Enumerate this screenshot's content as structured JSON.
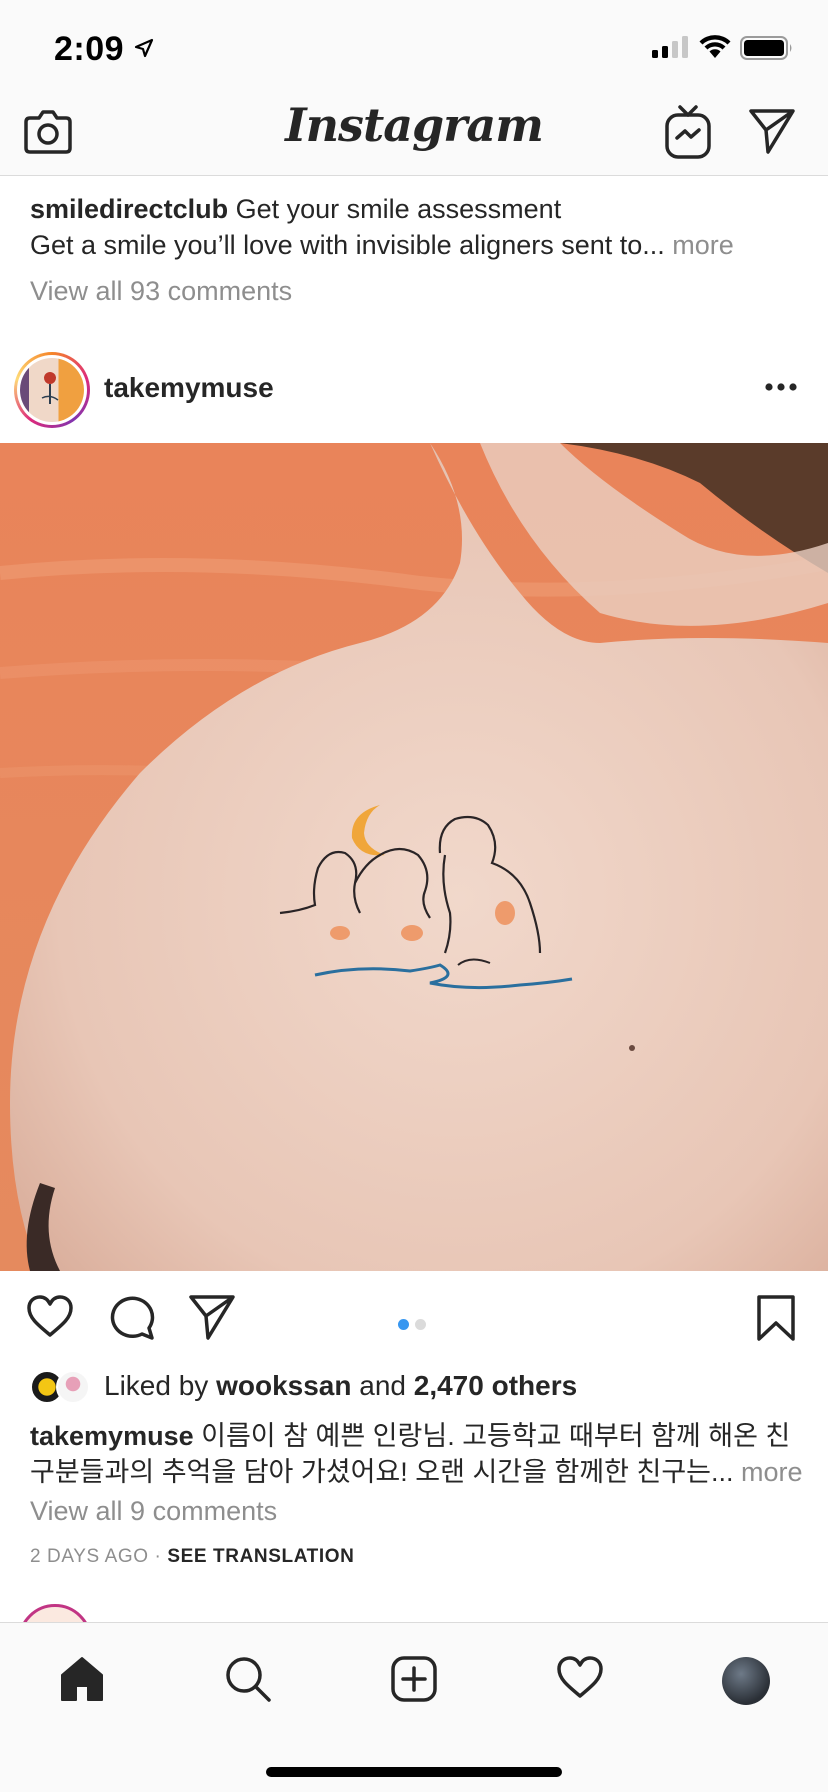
{
  "status_bar": {
    "time": "2:09",
    "icons": [
      "location-arrow-icon",
      "cellular-signal-icon",
      "wifi-icon",
      "battery-icon"
    ]
  },
  "nav": {
    "logo": "Instagram",
    "icons": [
      "camera-icon",
      "igtv-icon",
      "direct-message-icon"
    ]
  },
  "previous_post": {
    "caption_username": "smiledirectclub",
    "caption_title": "Get your smile assessment",
    "caption_text": "Get a smile you’ll love with invisible aligners sent to...",
    "more_label": "more",
    "view_comments": "View all 93 comments"
  },
  "post": {
    "username": "takemymuse",
    "image_alt_icon": "tattoo-photo",
    "carousel": {
      "count": 2,
      "active_index": 0
    },
    "colors": {
      "accent_blue": "#3897f0",
      "inactive_dot": "#dbdbdb"
    },
    "likes": {
      "prefix": "Liked by",
      "user": "wookssan",
      "conjunction": "and",
      "others": "2,470 others"
    },
    "caption": {
      "username": "takemymuse",
      "line1": "이름이 참 예쁜 인랑님. 고등학교 때부터 함께 해온 친",
      "line2": "구분들과의 추억을 담아 가셨어요! 오랜 시간을 함께한 친구는...",
      "more_label": "more"
    },
    "view_comments": "View all 9 comments",
    "timestamp": "2 DAYS AGO",
    "separator": "·",
    "see_translation": "SEE TRANSLATION"
  },
  "tab_bar": {
    "items": [
      "home-icon",
      "search-icon",
      "new-post-icon",
      "activity-heart-icon",
      "profile-avatar"
    ]
  }
}
